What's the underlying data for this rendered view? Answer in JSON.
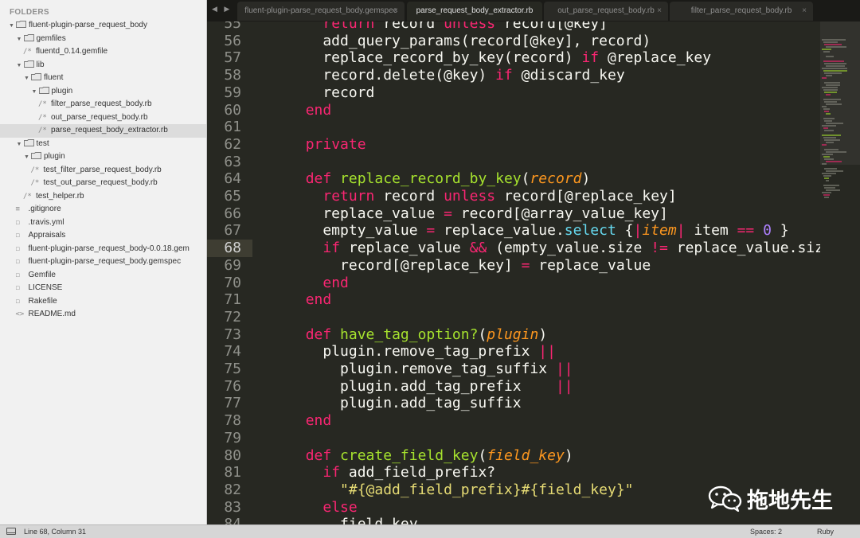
{
  "sidebar": {
    "header": "FOLDERS",
    "tree": [
      {
        "label": "fluent-plugin-parse_request_body",
        "type": "folder",
        "depth": 0,
        "expanded": true
      },
      {
        "label": "gemfiles",
        "type": "folder",
        "depth": 1,
        "expanded": true
      },
      {
        "label": "fluentd_0.14.gemfile",
        "type": "file",
        "depth": 2,
        "icon": "/*"
      },
      {
        "label": "lib",
        "type": "folder",
        "depth": 1,
        "expanded": true
      },
      {
        "label": "fluent",
        "type": "folder",
        "depth": 2,
        "expanded": true
      },
      {
        "label": "plugin",
        "type": "folder",
        "depth": 3,
        "expanded": true
      },
      {
        "label": "filter_parse_request_body.rb",
        "type": "file",
        "depth": 4,
        "icon": "/*"
      },
      {
        "label": "out_parse_request_body.rb",
        "type": "file",
        "depth": 4,
        "icon": "/*"
      },
      {
        "label": "parse_request_body_extractor.rb",
        "type": "file",
        "depth": 4,
        "icon": "/*",
        "selected": true
      },
      {
        "label": "test",
        "type": "folder",
        "depth": 1,
        "expanded": true
      },
      {
        "label": "plugin",
        "type": "folder",
        "depth": 2,
        "expanded": true
      },
      {
        "label": "test_filter_parse_request_body.rb",
        "type": "file",
        "depth": 3,
        "icon": "/*"
      },
      {
        "label": "test_out_parse_request_body.rb",
        "type": "file",
        "depth": 3,
        "icon": "/*"
      },
      {
        "label": "test_helper.rb",
        "type": "file",
        "depth": 2,
        "icon": "/*"
      },
      {
        "label": ".gitignore",
        "type": "file",
        "depth": 1,
        "icon": "≡"
      },
      {
        "label": ".travis.yml",
        "type": "file",
        "depth": 1,
        "icon": "☐"
      },
      {
        "label": "Appraisals",
        "type": "file",
        "depth": 1,
        "icon": "☐"
      },
      {
        "label": "fluent-plugin-parse_request_body-0.0.18.gem",
        "type": "file",
        "depth": 1,
        "icon": "☐"
      },
      {
        "label": "fluent-plugin-parse_request_body.gemspec",
        "type": "file",
        "depth": 1,
        "icon": "☐"
      },
      {
        "label": "Gemfile",
        "type": "file",
        "depth": 1,
        "icon": "☐"
      },
      {
        "label": "LICENSE",
        "type": "file",
        "depth": 1,
        "icon": "☐"
      },
      {
        "label": "Rakefile",
        "type": "file",
        "depth": 1,
        "icon": "☐"
      },
      {
        "label": "README.md",
        "type": "file",
        "depth": 1,
        "icon": "<>"
      }
    ]
  },
  "tabbar": {
    "nav_arrows": "◀ ▶",
    "tabs": [
      {
        "label": "fluent-plugin-parse_request_body.gemspec",
        "active": false
      },
      {
        "label": "parse_request_body_extractor.rb",
        "active": true
      },
      {
        "label": "out_parse_request_body.rb",
        "active": false
      },
      {
        "label": "filter_parse_request_body.rb",
        "active": false
      }
    ],
    "close_glyph": "×"
  },
  "editor": {
    "current_line": 68,
    "lines": [
      {
        "n": 55,
        "tokens": [
          [
            "    ",
            "p"
          ],
          [
            "return",
            "kw"
          ],
          [
            " record ",
            "p"
          ],
          [
            "unless",
            "kw"
          ],
          [
            " record[@key]",
            "p"
          ]
        ]
      },
      {
        "n": 56,
        "tokens": [
          [
            "    add_query_params(record[@key], record)",
            "p"
          ]
        ]
      },
      {
        "n": 57,
        "tokens": [
          [
            "    replace_record_by_key(record) ",
            "p"
          ],
          [
            "if",
            "kw"
          ],
          [
            " @replace_key",
            "p"
          ]
        ]
      },
      {
        "n": 58,
        "tokens": [
          [
            "    record.delete(@key) ",
            "p"
          ],
          [
            "if",
            "kw"
          ],
          [
            " @discard_key",
            "p"
          ]
        ]
      },
      {
        "n": 59,
        "tokens": [
          [
            "    record",
            "p"
          ]
        ]
      },
      {
        "n": 60,
        "tokens": [
          [
            "  ",
            "p"
          ],
          [
            "end",
            "kw"
          ]
        ]
      },
      {
        "n": 61,
        "tokens": []
      },
      {
        "n": 62,
        "tokens": [
          [
            "  ",
            "p"
          ],
          [
            "private",
            "kw"
          ]
        ]
      },
      {
        "n": 63,
        "tokens": []
      },
      {
        "n": 64,
        "tokens": [
          [
            "  ",
            "p"
          ],
          [
            "def",
            "kw"
          ],
          [
            " ",
            "p"
          ],
          [
            "replace_record_by_key",
            "fn"
          ],
          [
            "(",
            "p"
          ],
          [
            "record",
            "param"
          ],
          [
            ")",
            "p"
          ]
        ]
      },
      {
        "n": 65,
        "tokens": [
          [
            "    ",
            "p"
          ],
          [
            "return",
            "kw"
          ],
          [
            " record ",
            "p"
          ],
          [
            "unless",
            "kw"
          ],
          [
            " record[@replace_key]",
            "p"
          ]
        ]
      },
      {
        "n": 66,
        "tokens": [
          [
            "    replace_value ",
            "p"
          ],
          [
            "=",
            "kw"
          ],
          [
            " record[@array_value_key]",
            "p"
          ]
        ]
      },
      {
        "n": 67,
        "tokens": [
          [
            "    empty_value ",
            "p"
          ],
          [
            "=",
            "kw"
          ],
          [
            " replace_value.",
            "p"
          ],
          [
            "select",
            "call"
          ],
          [
            " {",
            "p"
          ],
          [
            "|",
            "kw"
          ],
          [
            "item",
            "param"
          ],
          [
            "|",
            "kw"
          ],
          [
            " item ",
            "p"
          ],
          [
            "==",
            "kw"
          ],
          [
            " ",
            "p"
          ],
          [
            "0",
            "num"
          ],
          [
            " }",
            "p"
          ]
        ]
      },
      {
        "n": 68,
        "tokens": [
          [
            "    ",
            "p"
          ],
          [
            "if",
            "kw"
          ],
          [
            " replace_value ",
            "p"
          ],
          [
            "&&",
            "kw"
          ],
          [
            " (empty_value.size ",
            "p"
          ],
          [
            "!=",
            "kw"
          ],
          [
            " replace_value.size)",
            "p"
          ]
        ]
      },
      {
        "n": 69,
        "tokens": [
          [
            "      record[@replace_key] ",
            "p"
          ],
          [
            "=",
            "kw"
          ],
          [
            " replace_value",
            "p"
          ]
        ]
      },
      {
        "n": 70,
        "tokens": [
          [
            "    ",
            "p"
          ],
          [
            "end",
            "kw"
          ]
        ]
      },
      {
        "n": 71,
        "tokens": [
          [
            "  ",
            "p"
          ],
          [
            "end",
            "kw"
          ]
        ]
      },
      {
        "n": 72,
        "tokens": []
      },
      {
        "n": 73,
        "tokens": [
          [
            "  ",
            "p"
          ],
          [
            "def",
            "kw"
          ],
          [
            " ",
            "p"
          ],
          [
            "have_tag_option?",
            "fn"
          ],
          [
            "(",
            "p"
          ],
          [
            "plugin",
            "param"
          ],
          [
            ")",
            "p"
          ]
        ]
      },
      {
        "n": 74,
        "tokens": [
          [
            "    plugin.remove_tag_prefix ",
            "p"
          ],
          [
            "||",
            "kw"
          ]
        ]
      },
      {
        "n": 75,
        "tokens": [
          [
            "      plugin.remove_tag_suffix ",
            "p"
          ],
          [
            "||",
            "kw"
          ]
        ]
      },
      {
        "n": 76,
        "tokens": [
          [
            "      plugin.add_tag_prefix    ",
            "p"
          ],
          [
            "||",
            "kw"
          ]
        ]
      },
      {
        "n": 77,
        "tokens": [
          [
            "      plugin.add_tag_suffix",
            "p"
          ]
        ]
      },
      {
        "n": 78,
        "tokens": [
          [
            "  ",
            "p"
          ],
          [
            "end",
            "kw"
          ]
        ]
      },
      {
        "n": 79,
        "tokens": []
      },
      {
        "n": 80,
        "tokens": [
          [
            "  ",
            "p"
          ],
          [
            "def",
            "kw"
          ],
          [
            " ",
            "p"
          ],
          [
            "create_field_key",
            "fn"
          ],
          [
            "(",
            "p"
          ],
          [
            "field_key",
            "param"
          ],
          [
            ")",
            "p"
          ]
        ]
      },
      {
        "n": 81,
        "tokens": [
          [
            "    ",
            "p"
          ],
          [
            "if",
            "kw"
          ],
          [
            " add_field_prefix?",
            "p"
          ]
        ]
      },
      {
        "n": 82,
        "tokens": [
          [
            "      ",
            "p"
          ],
          [
            "\"#{@add_field_prefix}#{field_key}\"",
            "str"
          ]
        ]
      },
      {
        "n": 83,
        "tokens": [
          [
            "    ",
            "p"
          ],
          [
            "else",
            "kw"
          ]
        ]
      },
      {
        "n": 84,
        "tokens": [
          [
            "      field_key",
            "p"
          ]
        ]
      }
    ]
  },
  "watermark": {
    "text": "拖地先生",
    "icon": "wechat-icon"
  },
  "statusbar": {
    "position": "Line 68, Column 31",
    "spaces": "Spaces: 2",
    "syntax": "Ruby"
  },
  "colors": {
    "background": "#272822",
    "keyword": "#f92672",
    "function": "#a6e22e",
    "parameter": "#fd971f",
    "string": "#e6db74",
    "number": "#ae81ff",
    "call": "#66d9ef",
    "text": "#f8f8f2"
  }
}
